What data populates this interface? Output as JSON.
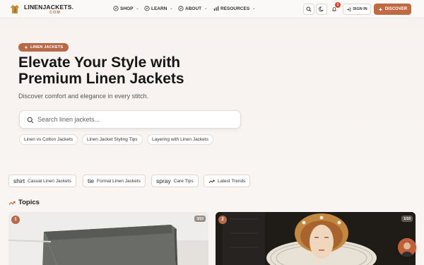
{
  "brand": {
    "name": "LINENJACKETS.",
    "sub": "COM"
  },
  "nav": {
    "items": [
      {
        "label": "SHOP",
        "icon": "compass-icon"
      },
      {
        "label": "LEARN",
        "icon": "compass-icon"
      },
      {
        "label": "ABOUT",
        "icon": "compass-icon"
      },
      {
        "label": "RESOURCES",
        "icon": "bar-chart-icon"
      }
    ],
    "notification_count": "1",
    "signin_label": "SIGN IN",
    "discover_label": "DISCOVER"
  },
  "hero": {
    "badge": "LINEN JACKETS",
    "title": "Elevate Your Style with Premium Linen Jackets",
    "subtitle": "Discover comfort and elegance in every stitch.",
    "search_placeholder": "Search linen jackets...",
    "suggestions": [
      "Linen vs Cotton Jackets",
      "Linen Jacket Styling Tips",
      "Layering with Linen Jackets"
    ]
  },
  "categories": [
    {
      "icon_word": "shirt",
      "label": "Casual Linen Jackets"
    },
    {
      "icon_word": "tie",
      "label": "Formal Linen Jackets"
    },
    {
      "icon_word": "spray",
      "label": "Care Tips"
    },
    {
      "icon_word": "",
      "label": "Latest Trends",
      "icon": "trending-icon"
    }
  ],
  "topics": {
    "heading": "Topics",
    "cards": [
      {
        "number": "1",
        "count": "3/10"
      },
      {
        "number": "2",
        "count": "1/10"
      }
    ]
  },
  "colors": {
    "accent": "#c06a43",
    "badge": "#b86a48",
    "notification": "#d9442e"
  }
}
